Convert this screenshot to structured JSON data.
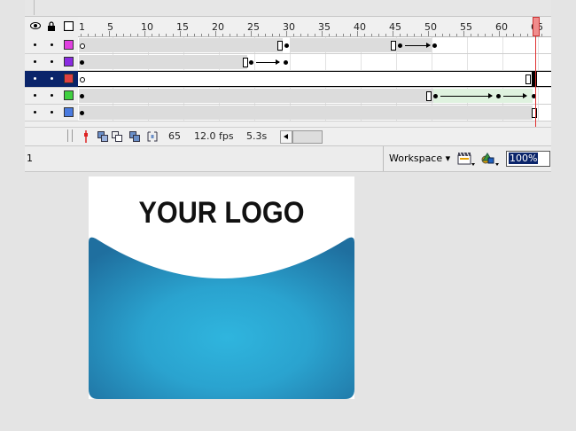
{
  "timeline": {
    "ruler_labels": [
      "1",
      "5",
      "10",
      "15",
      "20",
      "25",
      "30",
      "35",
      "40",
      "45",
      "50",
      "55",
      "60",
      "65"
    ],
    "footer": {
      "current_frame": "65",
      "fps": "12.0 fps",
      "elapsed": "5.3s"
    },
    "layers": [
      {
        "color": "#e040e0",
        "selected": false
      },
      {
        "color": "#8a2be2",
        "selected": false
      },
      {
        "color": "#e04040",
        "selected": true
      },
      {
        "color": "#40d040",
        "selected": false
      },
      {
        "color": "#4a7be0",
        "selected": false
      }
    ],
    "header_icons": [
      "eye-icon",
      "lock-icon",
      "outline-icon"
    ]
  },
  "edit_bar": {
    "scene_label": "1",
    "workspace_label": "Workspace ▾",
    "zoom_value": "100%",
    "icons": [
      "edit-symbols-icon",
      "edit-scene-icon"
    ]
  },
  "stage": {
    "logo_text": "YOUR LOGO",
    "colors": {
      "gradient_center": "#2fb2dc",
      "gradient_edge": "#2176a4",
      "background": "#ffffff"
    }
  }
}
